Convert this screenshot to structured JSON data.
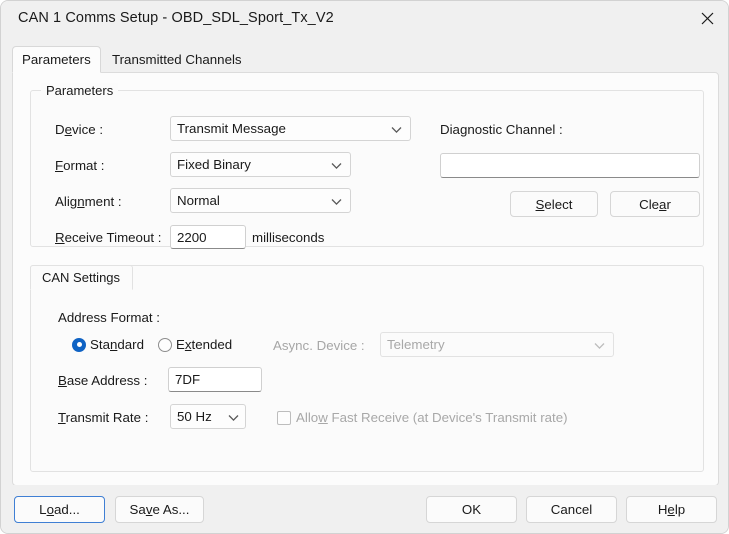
{
  "window": {
    "title": "CAN 1 Comms Setup - OBD_SDL_Sport_Tx_V2",
    "close_icon": "close-icon"
  },
  "tabs": [
    {
      "label": "Parameters",
      "selected": true
    },
    {
      "label": "Transmitted Channels",
      "selected": false
    }
  ],
  "parameters_group": {
    "legend": "Parameters",
    "device": {
      "label_pre": "D",
      "label_accel": "e",
      "label_post": "vice :",
      "value": "Transmit Message"
    },
    "format": {
      "label_pre": "",
      "label_accel": "F",
      "label_post": "ormat :",
      "value": "Fixed Binary"
    },
    "alignment": {
      "label_pre": "Alig",
      "label_accel": "n",
      "label_post": "ment :",
      "value": "Normal"
    },
    "receive_timeout": {
      "label_pre": "",
      "label_accel": "R",
      "label_post": "eceive Timeout :",
      "value": "2200",
      "units": "milliseconds"
    },
    "diagnostic_channel": {
      "label_pre": "Dia",
      "label_accel": "g",
      "label_post": "nostic Channel :",
      "value": "",
      "select_button": {
        "pre": "",
        "accel": "S",
        "post": "elect"
      },
      "clear_button": {
        "pre": "Cle",
        "accel": "a",
        "post": "r"
      }
    }
  },
  "can_settings_group": {
    "legend": "CAN Settings",
    "address_format_label": "Address Format :",
    "radios": [
      {
        "pre": "Sta",
        "accel": "n",
        "post": "dard",
        "checked": true
      },
      {
        "pre": "E",
        "accel": "x",
        "post": "tended",
        "checked": false
      }
    ],
    "async_device": {
      "label": "Async. Device :",
      "value": "Telemetry",
      "disabled": true
    },
    "base_address": {
      "label_pre": "",
      "label_accel": "B",
      "label_post": "ase Address :",
      "value": "7DF"
    },
    "transmit_rate": {
      "label_pre": "",
      "label_accel": "T",
      "label_post": "ransmit Rate :",
      "value": "50 Hz"
    },
    "allow_fast_receive": {
      "pre": "Allo",
      "accel": "w",
      "post": " Fast Receive (at Device's Transmit rate)",
      "checked": false,
      "disabled": true
    }
  },
  "footer_buttons": {
    "load": {
      "pre": "L",
      "accel": "o",
      "post": "ad...",
      "focused": true
    },
    "save_as": {
      "pre": "Sa",
      "accel": "v",
      "post": "e As..."
    },
    "ok": {
      "pre": "OK",
      "accel": "",
      "post": ""
    },
    "cancel": {
      "pre": "Cancel",
      "accel": "",
      "post": ""
    },
    "help": {
      "pre": "H",
      "accel": "e",
      "post": "lp"
    }
  },
  "colors": {
    "window_bg": "#f0f0f0",
    "panel_bg": "#fcfcfc",
    "accent_focus": "#3f7fd4",
    "radio_selected": "#0f63c4",
    "text": "#1a1a1a",
    "disabled_text": "#a8a8a8"
  }
}
